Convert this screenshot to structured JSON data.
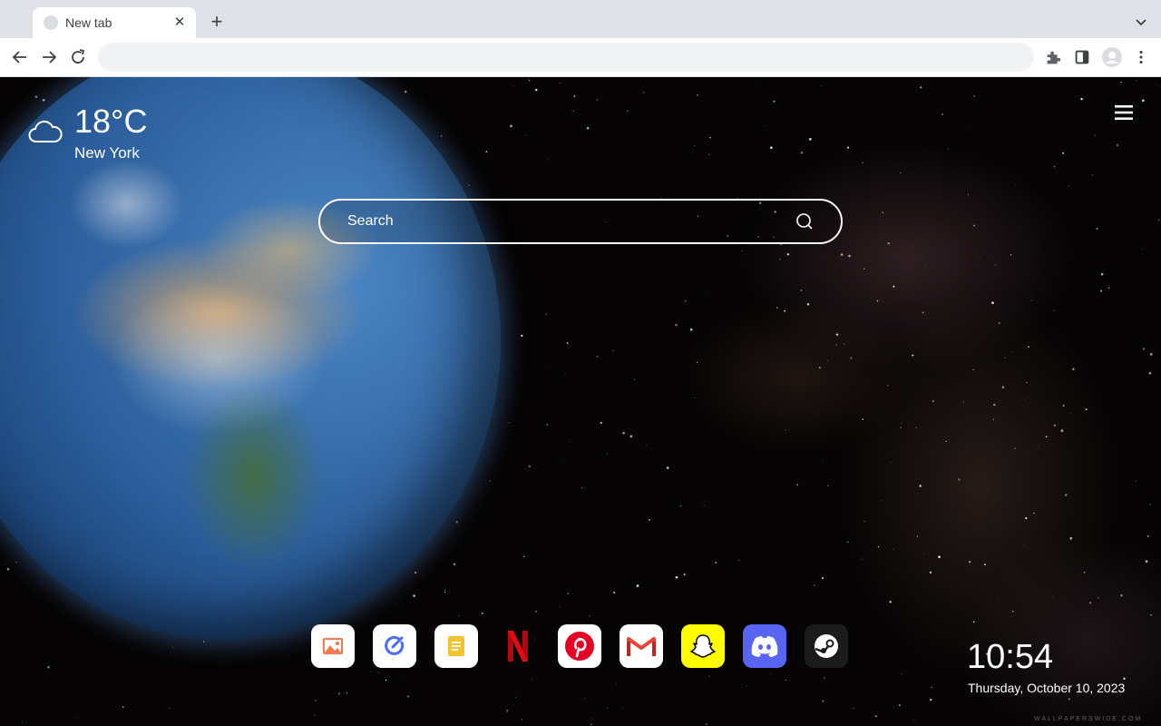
{
  "browser": {
    "tab": {
      "title": "New tab"
    },
    "omnibox": {
      "value": ""
    }
  },
  "weather": {
    "temperature": "18°C",
    "city": "New York",
    "icon": "cloud-icon"
  },
  "search": {
    "placeholder": "Search"
  },
  "apps": [
    {
      "name": "photos",
      "icon": "image-icon",
      "bg": "#ffffff"
    },
    {
      "name": "tasks",
      "icon": "check-circle-icon",
      "bg": "#ffffff"
    },
    {
      "name": "notes",
      "icon": "note-icon",
      "bg": "#ffffff"
    },
    {
      "name": "netflix",
      "icon": "netflix-icon",
      "bg": "transparent"
    },
    {
      "name": "pinterest",
      "icon": "pinterest-icon",
      "bg": "#ffffff"
    },
    {
      "name": "gmail",
      "icon": "gmail-icon",
      "bg": "#ffffff"
    },
    {
      "name": "snapchat",
      "icon": "snapchat-icon",
      "bg": "#fffc00"
    },
    {
      "name": "discord",
      "icon": "discord-icon",
      "bg": "#5865f2"
    },
    {
      "name": "steam",
      "icon": "steam-icon",
      "bg": "#1b1b1b"
    }
  ],
  "clock": {
    "time": "10:54",
    "date": "Thursday, October 10, 2023"
  },
  "watermark": "WALLPAPERSWIDE.COM",
  "colors": {
    "netflix": "#e50914",
    "pinterest": "#e60023",
    "snapchat": "#fffc00",
    "discord": "#5865f2",
    "tasks_blue": "#4a6cf7",
    "notes_yellow": "#f4c430"
  }
}
